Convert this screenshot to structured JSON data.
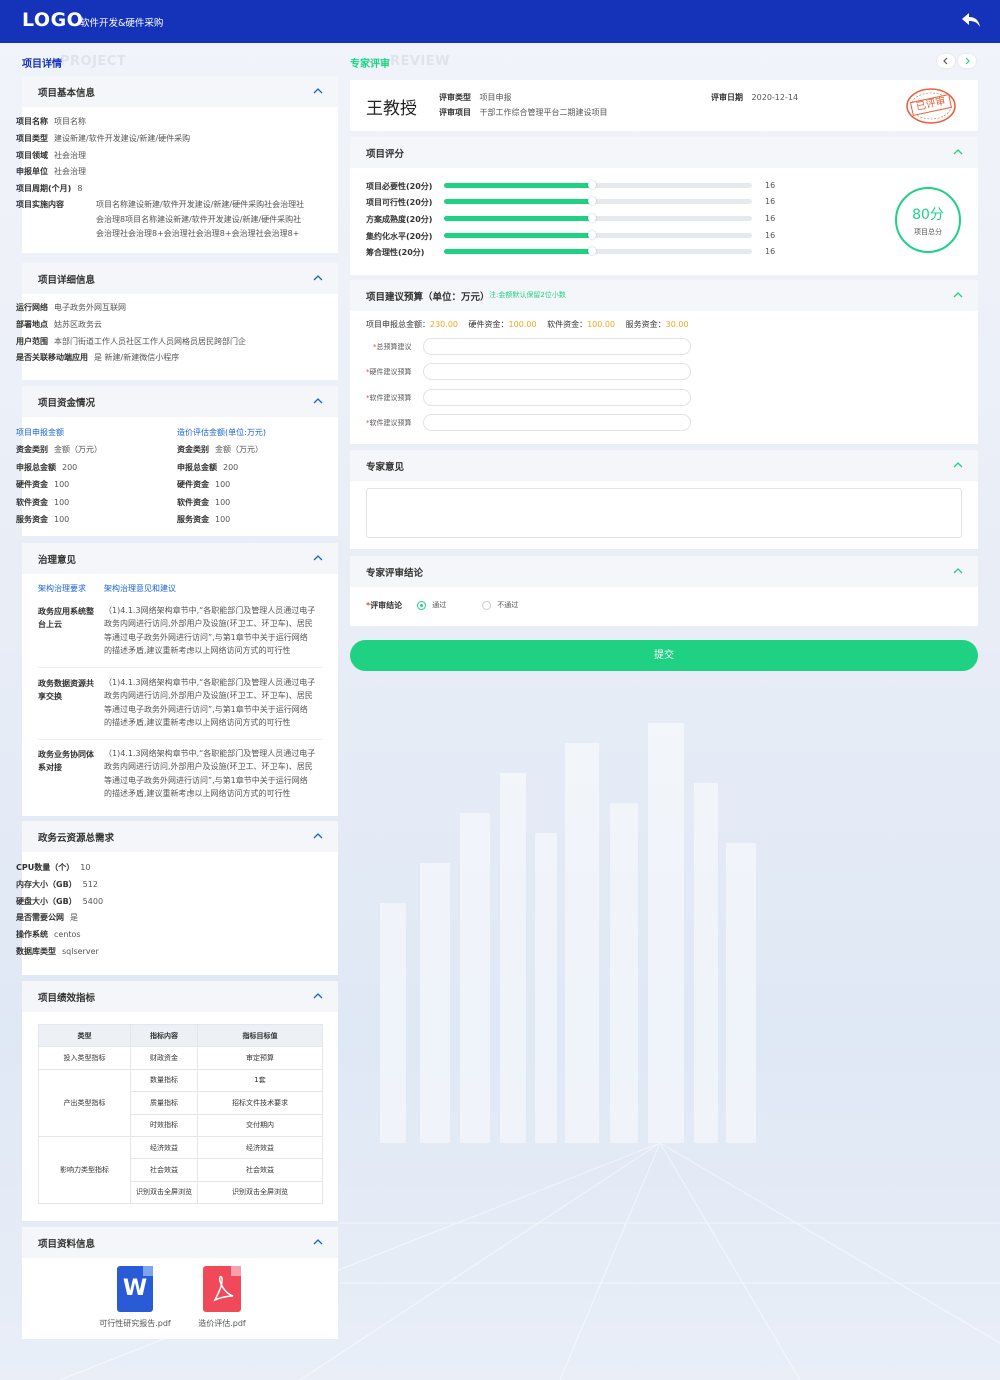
{
  "header": {
    "logo": "LOGO",
    "subtitle": "软件开发&硬件采购"
  },
  "left_section": {
    "title": "项目详情",
    "bg": "PROJECT"
  },
  "right_section": {
    "title": "专家评审",
    "bg": "REVIEW"
  },
  "basic_info": {
    "title": "项目基本信息",
    "rows": [
      {
        "k": "项目名称",
        "v": "项目名称"
      },
      {
        "k": "项目类型",
        "v": "建设新建/软件开发建设/新建/硬件采购"
      },
      {
        "k": "项目领域",
        "v": "社会治理"
      },
      {
        "k": "申报单位",
        "v": "社会治理"
      },
      {
        "k": "项目周期(个月)",
        "v": "8"
      }
    ],
    "content_k": "项目实施内容",
    "content_lines": [
      "项目名称建设新建/软件开发建设/新建/硬件采购社会治理社",
      "会治理8项目名称建设新建/软件开发建设/新建/硬件采购社",
      "会治理社会治理8+会治理社会治理8+会治理社会治理8+"
    ]
  },
  "detail_info": {
    "title": "项目详细信息",
    "rows": [
      {
        "k": "运行网络",
        "v": "电子政务外网互联网"
      },
      {
        "k": "部署地点",
        "v": "姑苏区政务云"
      },
      {
        "k": "用户范围",
        "v": "本部门街道工作人员社区工作人员网格员居民跨部门企"
      },
      {
        "k": "是否关联移动端应用",
        "v": "是   新建/新建微信小程序"
      }
    ]
  },
  "funds": {
    "title": "项目资金情况",
    "left_head": "项目申报金额",
    "right_head": "造价评估金额(单位:万元)",
    "left_rows": [
      {
        "k": "资金类别",
        "v": "金额（万元）"
      },
      {
        "k": "申报总金额",
        "v": "200"
      },
      {
        "k": "硬件资金",
        "v": "100"
      },
      {
        "k": "软件资金",
        "v": "100"
      },
      {
        "k": "服务资金",
        "v": "100"
      }
    ],
    "right_rows": [
      {
        "k": "资金类别",
        "v": "金额（万元）"
      },
      {
        "k": "申报总金额",
        "v": "200"
      },
      {
        "k": "硬件资金",
        "v": "100"
      },
      {
        "k": "软件资金",
        "v": "100"
      },
      {
        "k": "服务资金",
        "v": "100"
      }
    ]
  },
  "governance": {
    "title": "治理意见",
    "tab1": "架构治理要求",
    "tab2": "架构治理意见和建议",
    "items": [
      {
        "k": "政务应用系统整台上云",
        "lines": [
          "（1)4.1.3网络架构章节中,“各职能部门及管理人员通过电子",
          "政务内网进行访问,外部用户及设施(环卫工、环卫车)、居民",
          "等通过电子政务外网进行访问”,与第1章节中关于运行网络",
          "的描述矛盾,建议重新考虑以上网络访问方式的可行性"
        ]
      },
      {
        "k": "政务数据资源共享交换",
        "lines": [
          "（1)4.1.3网络架构章节中,“各职能部门及管理人员通过电子",
          "政务内网进行访问,外部用户及设施(环卫工、环卫车)、居民",
          "等通过电子政务外网进行访问”,与第1章节中关于运行网络",
          "的描述矛盾,建议重新考虑以上网络访问方式的可行性"
        ]
      },
      {
        "k": "政务业务协同体系对接",
        "lines": [
          "（1)4.1.3网络架构章节中,“各职能部门及管理人员通过电子",
          "政务内网进行访问,外部用户及设施(环卫工、环卫车)、居民",
          "等通过电子政务外网进行访问”,与第1章节中关于运行网络",
          "的描述矛盾,建议重新考虑以上网络访问方式的可行性"
        ]
      }
    ]
  },
  "cloud": {
    "title": "政务云资源总需求",
    "rows": [
      {
        "k": "CPU数量（个）",
        "v": "10"
      },
      {
        "k": "内存大小（GB）",
        "v": "512"
      },
      {
        "k": "硬盘大小（GB）",
        "v": "5400"
      },
      {
        "k": "是否需要公网",
        "v": "是"
      },
      {
        "k": "操作系统",
        "v": "centos"
      },
      {
        "k": "数据库类型",
        "v": "sqlserver"
      }
    ]
  },
  "perf": {
    "title": "项目绩效指标",
    "headers": [
      "类型",
      "指标内容",
      "指标目标值"
    ],
    "g1": "投入类型指标",
    "g2": "产出类型指标",
    "g3": "影响力类型指标",
    "rows": [
      {
        "c": "财政资金",
        "t": "审定预算"
      },
      {
        "c": "数量指标",
        "t": "1套"
      },
      {
        "c": "质量指标",
        "t": "招标文件技术要求"
      },
      {
        "c": "时效指标",
        "t": "交付期内"
      },
      {
        "c": "经济效益",
        "t": "经济效益"
      },
      {
        "c": "社会效益",
        "t": "社会效益"
      },
      {
        "c": "识别双击全屏浏览",
        "t": "识别双击全屏浏览"
      }
    ]
  },
  "files": {
    "title": "项目资料信息",
    "word_name": "可行性研究报告.pdf",
    "pdf_name": "造价评估.pdf",
    "word_letter": "W"
  },
  "expert": {
    "name": "王教授",
    "type_k": "评审类型",
    "type_v": "项目申报",
    "proj_k": "评审项目",
    "proj_v": "干部工作综合管理平台二期建设项目",
    "date_k": "评审日期",
    "date_v": "2020-12-14",
    "stamp": "已评审"
  },
  "score": {
    "title": "项目评分",
    "items": [
      {
        "label": "项目必要性(20分)",
        "value": 16,
        "max": 20
      },
      {
        "label": "项目可行性(20分)",
        "value": 16,
        "max": 20
      },
      {
        "label": "方案成熟度(20分)",
        "value": 16,
        "max": 20
      },
      {
        "label": "集约化水平(20分)",
        "value": 16,
        "max": 20
      },
      {
        "label": "筹合理性(20分)",
        "value": 16,
        "max": 20
      }
    ],
    "total": "80分",
    "total_label": "项目总分"
  },
  "budget": {
    "title": "项目建议预算（单位：万元）",
    "note": "注:金额默认保留2位小数",
    "total_k": "项目申报总金额：",
    "total_v": "230.00",
    "hw_k": "硬件资金：",
    "hw_v": "100.00",
    "sw_k": "软件资金：",
    "sw_v": "100.00",
    "svc_k": "服务资金：",
    "svc_v": "30.00",
    "fields": [
      {
        "label": "总预算建议",
        "placeholder": ""
      },
      {
        "label": "硬件建议预算",
        "placeholder": ""
      },
      {
        "label": "软件建议预算",
        "placeholder": ""
      },
      {
        "label": "软件建议预算",
        "placeholder": ""
      }
    ]
  },
  "opinion": {
    "title": "专家意见",
    "value": ""
  },
  "conclusion": {
    "title": "专家评审结论",
    "label": "评审结论",
    "pass": "通过",
    "fail": "不通过",
    "selected": "通过"
  },
  "submit": "提交",
  "colors": {
    "header": "#1433b8",
    "accent": "#1fd283",
    "link": "#1a63d6",
    "amount": "#f2a41e",
    "stamp": "#e8603c"
  }
}
